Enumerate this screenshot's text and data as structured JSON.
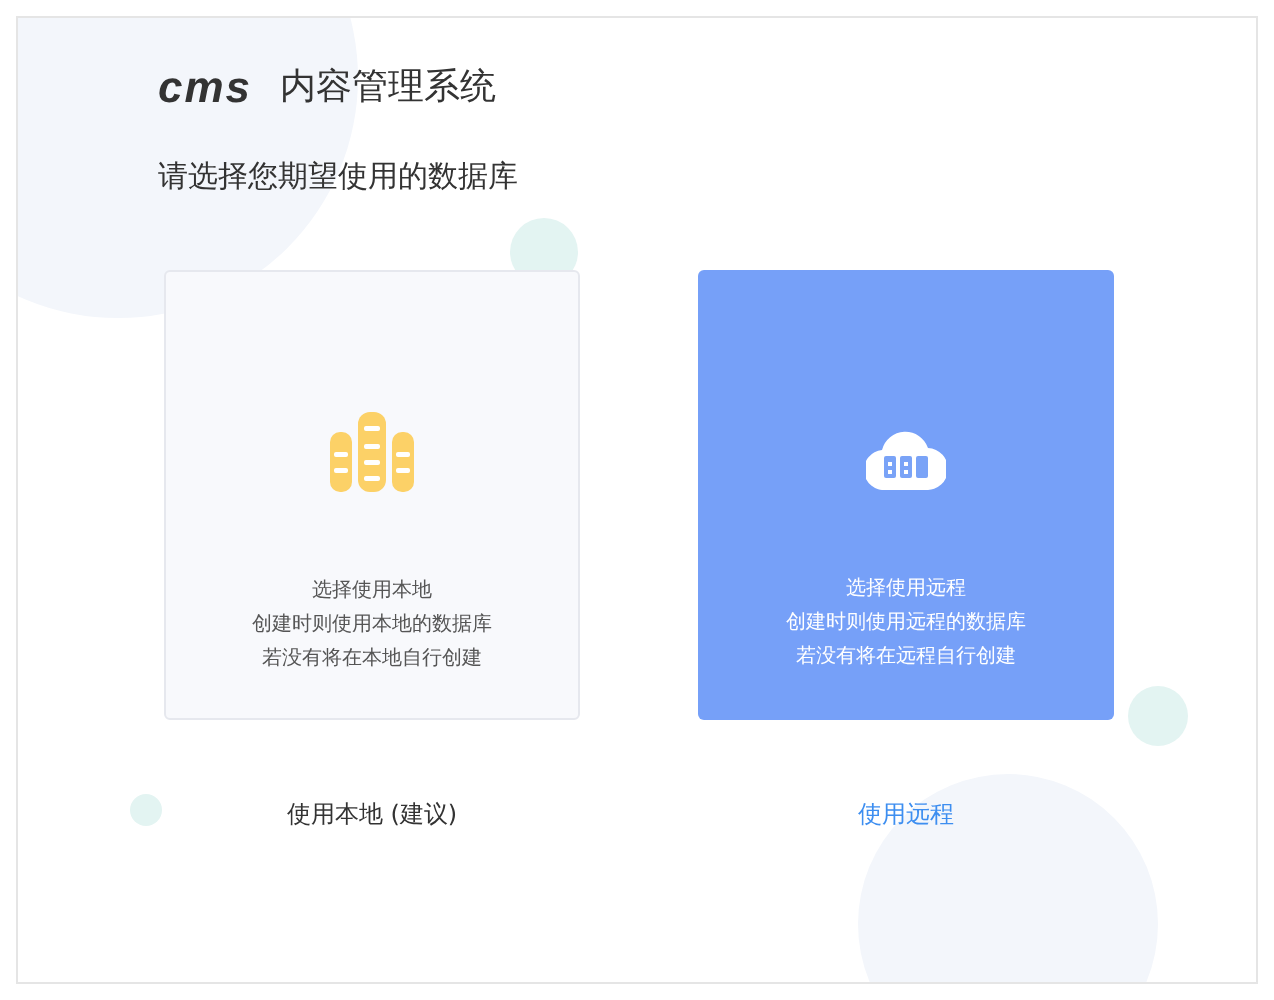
{
  "header": {
    "logo": "cms",
    "title": "内容管理系统"
  },
  "prompt": "请选择您期望使用的数据库",
  "options": [
    {
      "kind": "local",
      "selected": false,
      "lines": [
        "选择使用本地",
        "创建时则使用本地的数据库",
        "若没有将在本地自行创建"
      ],
      "button": "使用本地 (建议)"
    },
    {
      "kind": "remote",
      "selected": true,
      "lines": [
        "选择使用远程",
        "创建时则使用远程的数据库",
        "若没有将在远程自行创建"
      ],
      "button": "使用远程"
    }
  ]
}
